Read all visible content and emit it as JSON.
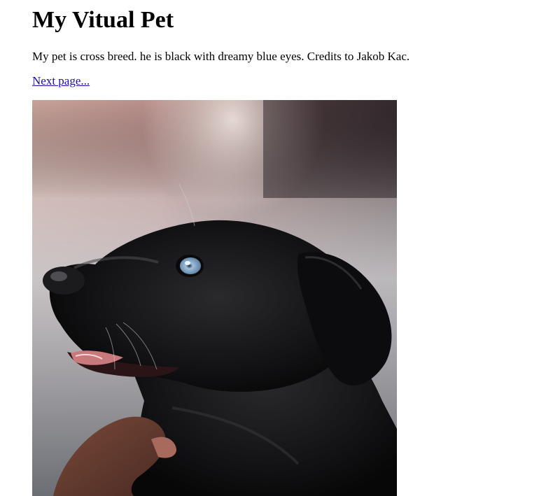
{
  "page": {
    "title": "My Vitual Pet",
    "description": "My pet is cross breed. he is black with dreamy blue eyes. Credits to Jakob Kac.",
    "next_link": "Next page..."
  },
  "photo": {
    "subject": "black puppy with blue eyes looking up",
    "colors": {
      "fur": "#141414",
      "eye": "#9fc0de",
      "tongue": "#c9787b",
      "hand": "#6b3e32"
    }
  },
  "link_color": "#1a0dab"
}
